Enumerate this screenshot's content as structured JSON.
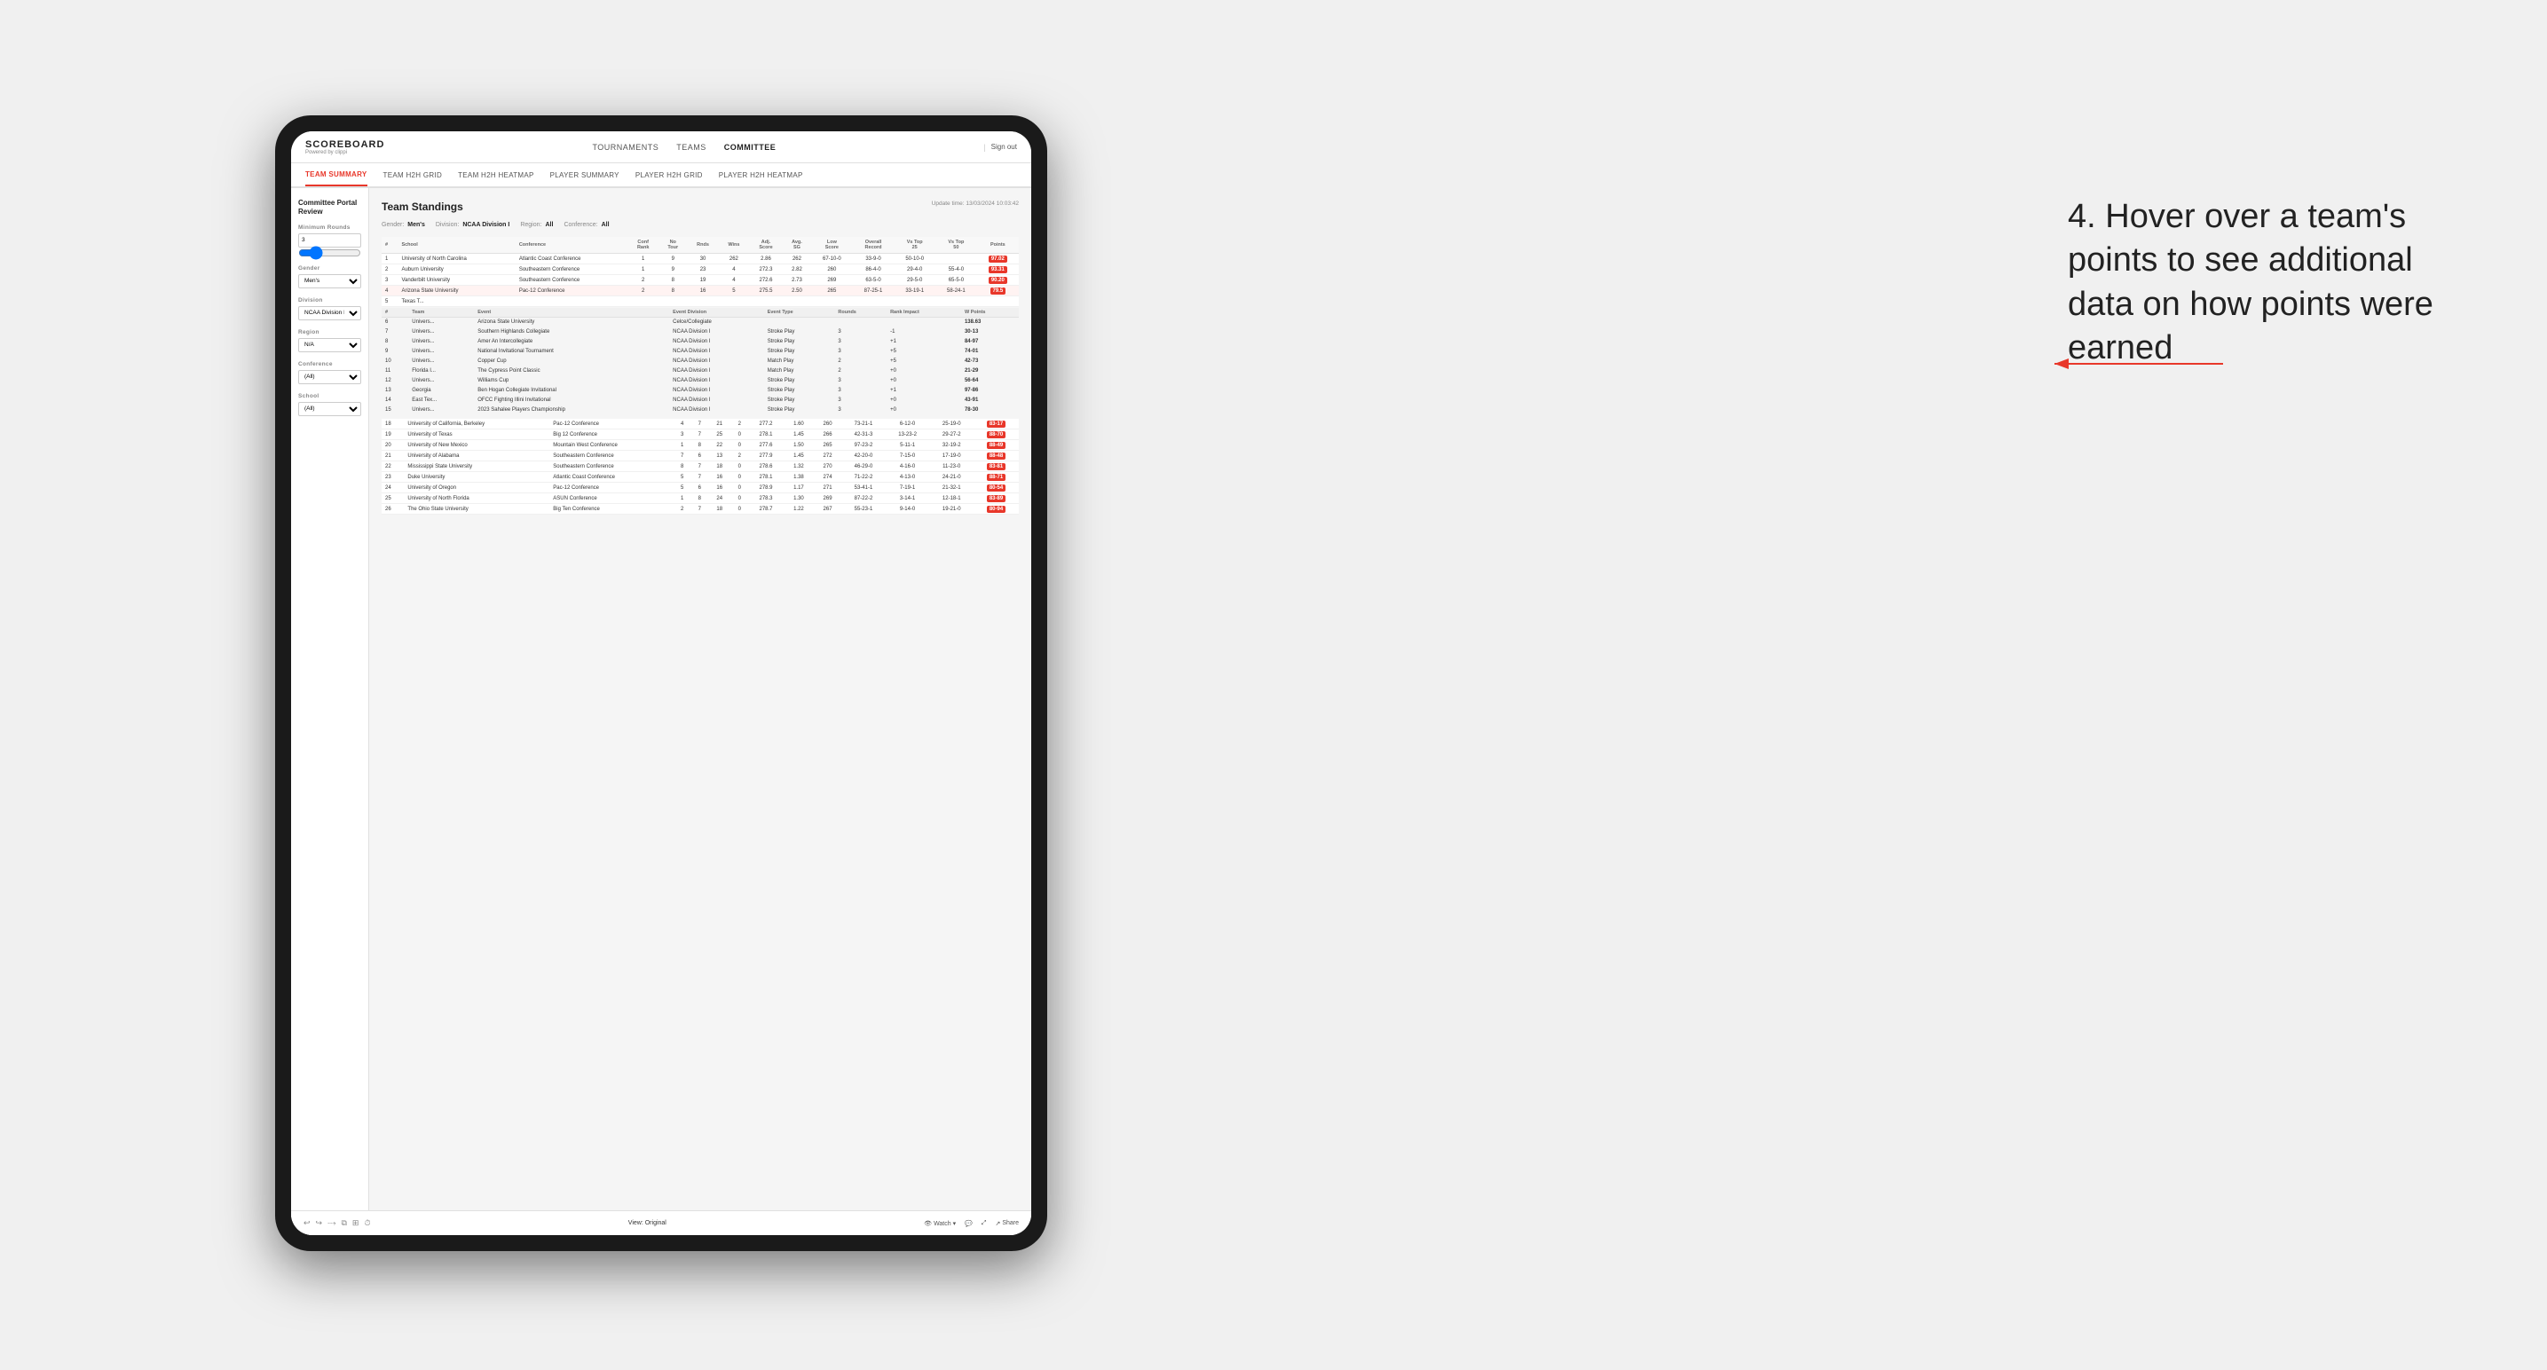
{
  "app": {
    "title": "SCOREBOARD",
    "subtitle": "Powered by clippi",
    "sign_out": "Sign out"
  },
  "nav": {
    "links": [
      "TOURNAMENTS",
      "TEAMS",
      "COMMITTEE"
    ]
  },
  "sub_tabs": [
    "TEAM SUMMARY",
    "TEAM H2H GRID",
    "TEAM H2H HEATMAP",
    "PLAYER SUMMARY",
    "PLAYER H2H GRID",
    "PLAYER H2H HEATMAP"
  ],
  "active_tab": "TEAM SUMMARY",
  "sidebar": {
    "header": "Committee Portal Review",
    "sections": [
      {
        "label": "Minimum Rounds",
        "value": ""
      },
      {
        "label": "Gender",
        "value": "Men's"
      },
      {
        "label": "Division",
        "value": "NCAA Division I"
      },
      {
        "label": "Region",
        "value": "N/A"
      },
      {
        "label": "Conference",
        "value": "(All)"
      },
      {
        "label": "School",
        "value": "(All)"
      }
    ]
  },
  "panel": {
    "title": "Team Standings",
    "update_time": "Update time: 13/03/2024 10:03:42",
    "filters": {
      "gender_label": "Gender:",
      "gender_value": "Men's",
      "division_label": "Division:",
      "division_value": "NCAA Division I",
      "region_label": "Region:",
      "region_value": "All",
      "conference_label": "Conference:",
      "conference_value": "All"
    },
    "table_headers": [
      "#",
      "School",
      "Conference",
      "Conf Rank",
      "No Tour",
      "Rnds",
      "Wins",
      "Adj. Score",
      "Avg. SG",
      "Low Score",
      "Overall Record",
      "Vs Top 25",
      "Vs Top 50",
      "Points"
    ],
    "teams": [
      {
        "rank": 1,
        "school": "University of North Carolina",
        "conference": "Atlantic Coast Conference",
        "conf_rank": 1,
        "no_tour": 9,
        "rnds": 30,
        "wins": 262,
        "adj_score": 2.86,
        "avg_sg": 262,
        "low_score": "67-10-0",
        "overall_record": "33-9-0",
        "vs_top25": "50-10-0",
        "points": "97.02",
        "highlighted": false
      },
      {
        "rank": 2,
        "school": "Auburn University",
        "conference": "Southeastern Conference",
        "conf_rank": 1,
        "no_tour": 9,
        "rnds": 23,
        "wins": 4,
        "adj_score": 272.3,
        "avg_sg": 2.82,
        "low_score": "260",
        "overall_record": "86-4-0",
        "vs_top25": "29-4-0",
        "vs_top50": "55-4-0",
        "points": "93.31",
        "highlighted": false
      },
      {
        "rank": 3,
        "school": "Vanderbilt University",
        "conference": "Southeastern Conference",
        "conf_rank": 2,
        "no_tour": 8,
        "rnds": 19,
        "wins": 4,
        "adj_score": 272.6,
        "avg_sg": 2.73,
        "low_score": "269",
        "overall_record": "63-5-0",
        "vs_top25": "29-5-0",
        "vs_top50": "65-5-0",
        "points": "90.20",
        "highlighted": false
      },
      {
        "rank": 4,
        "school": "Arizona State University",
        "conference": "Pac-12 Conference",
        "conf_rank": 2,
        "no_tour": 8,
        "rnds": 16,
        "wins": 5,
        "adj_score": 275.5,
        "avg_sg": 2.5,
        "low_score": "265",
        "overall_record": "87-25-1",
        "vs_top25": "33-19-1",
        "vs_top50": "58-24-1",
        "points": "79.5",
        "highlighted": true
      }
    ],
    "detail_rows": [
      {
        "team": "University",
        "event": "University",
        "event_division": "",
        "event_type": "",
        "rounds": "",
        "rank_impact": "",
        "w_points": ""
      },
      {
        "team": "Univers...",
        "event": "Southern Highlands Collegiate",
        "event_division": "NCAA Division I",
        "event_type": "Stroke Play",
        "rounds": 3,
        "rank_impact": "-1",
        "w_points": "30-13"
      },
      {
        "team": "Univers...",
        "event": "Amer An Intercollegiate",
        "event_division": "NCAA Division I",
        "event_type": "Stroke Play",
        "rounds": 3,
        "rank_impact": "+1",
        "w_points": "84-97"
      },
      {
        "team": "Univers...",
        "event": "National Invitational Tournament",
        "event_division": "NCAA Division I",
        "event_type": "Stroke Play",
        "rounds": 3,
        "rank_impact": "+5",
        "w_points": "74-01"
      },
      {
        "team": "Univers...",
        "event": "Copper Cup",
        "event_division": "NCAA Division I",
        "event_type": "Match Play",
        "rounds": 2,
        "rank_impact": "+5",
        "w_points": "42-73"
      },
      {
        "team": "Florida I...",
        "event": "The Cypress Point Classic",
        "event_division": "NCAA Division I",
        "event_type": "Match Play",
        "rounds": 2,
        "rank_impact": "+0",
        "w_points": "21-29"
      },
      {
        "team": "Univers...",
        "event": "Williams Cup",
        "event_division": "NCAA Division I",
        "event_type": "Stroke Play",
        "rounds": 3,
        "rank_impact": "+0",
        "w_points": "56-64"
      },
      {
        "team": "Georgia",
        "event": "Ben Hogan Collegiate Invitational",
        "event_division": "NCAA Division I",
        "event_type": "Stroke Play",
        "rounds": 3,
        "rank_impact": "+1",
        "w_points": "97-86"
      },
      {
        "team": "East Tex...",
        "event": "OFCC Fighting Illini Invitational",
        "event_division": "NCAA Division I",
        "event_type": "Stroke Play",
        "rounds": 3,
        "rank_impact": "+0",
        "w_points": "43-91"
      },
      {
        "team": "Univers...",
        "event": "2023 Sahalee Players Championship",
        "event_division": "NCAA Division I",
        "event_type": "Stroke Play",
        "rounds": 3,
        "rank_impact": "+0",
        "w_points": "78-30"
      }
    ],
    "bottom_teams": [
      {
        "rank": 18,
        "school": "University of California, Berkeley",
        "conference": "Pac-12 Conference",
        "conf_rank": 4,
        "no_tour": 7,
        "rnds": 21,
        "wins": 2,
        "adj_score": 277.2,
        "avg_sg": 1.6,
        "low_score": "260",
        "overall_record": "73-21-1",
        "vs_top25": "6-12-0",
        "vs_top50": "25-19-0",
        "points": "83-17"
      },
      {
        "rank": 19,
        "school": "University of Texas",
        "conference": "Big 12 Conference",
        "conf_rank": 3,
        "no_tour": 7,
        "rnds": 25,
        "wins": 0,
        "adj_score": 278.1,
        "avg_sg": 1.45,
        "low_score": "266",
        "overall_record": "42-31-3",
        "vs_top25": "13-23-2",
        "vs_top50": "29-27-2",
        "points": "88-70"
      },
      {
        "rank": 20,
        "school": "University of New Mexico",
        "conference": "Mountain West Conference",
        "conf_rank": 1,
        "no_tour": 8,
        "rnds": 22,
        "wins": 0,
        "adj_score": 277.6,
        "avg_sg": 1.5,
        "low_score": "265",
        "overall_record": "97-23-2",
        "vs_top25": "5-11-1",
        "vs_top50": "32-19-2",
        "points": "88-49"
      },
      {
        "rank": 21,
        "school": "University of Alabama",
        "conference": "Southeastern Conference",
        "conf_rank": 7,
        "no_tour": 6,
        "rnds": 13,
        "wins": 2,
        "adj_score": 277.9,
        "avg_sg": 1.45,
        "low_score": "272",
        "overall_record": "42-20-0",
        "vs_top25": "7-15-0",
        "vs_top50": "17-19-0",
        "points": "88-48"
      },
      {
        "rank": 22,
        "school": "Mississippi State University",
        "conference": "Southeastern Conference",
        "conf_rank": 8,
        "no_tour": 7,
        "rnds": 18,
        "wins": 0,
        "adj_score": 278.6,
        "avg_sg": 1.32,
        "low_score": "270",
        "overall_record": "46-29-0",
        "vs_top25": "4-16-0",
        "vs_top50": "11-23-0",
        "points": "83-81"
      },
      {
        "rank": 23,
        "school": "Duke University",
        "conference": "Atlantic Coast Conference",
        "conf_rank": 5,
        "no_tour": 7,
        "rnds": 16,
        "wins": 0,
        "adj_score": 278.1,
        "avg_sg": 1.38,
        "low_score": "274",
        "overall_record": "71-22-2",
        "vs_top25": "4-13-0",
        "vs_top50": "24-21-0",
        "points": "88-71"
      },
      {
        "rank": 24,
        "school": "University of Oregon",
        "conference": "Pac-12 Conference",
        "conf_rank": 5,
        "no_tour": 6,
        "rnds": 16,
        "wins": 0,
        "adj_score": 278.9,
        "avg_sg": 1.17,
        "low_score": "271",
        "overall_record": "53-41-1",
        "vs_top25": "7-19-1",
        "vs_top50": "21-32-1",
        "points": "80-54"
      },
      {
        "rank": 25,
        "school": "University of North Florida",
        "conference": "ASUN Conference",
        "conf_rank": 1,
        "no_tour": 8,
        "rnds": 24,
        "wins": 0,
        "adj_score": 278.3,
        "avg_sg": 1.3,
        "low_score": "269",
        "overall_record": "87-22-2",
        "vs_top25": "3-14-1",
        "vs_top50": "12-18-1",
        "points": "83-89"
      },
      {
        "rank": 26,
        "school": "The Ohio State University",
        "conference": "Big Ten Conference",
        "conf_rank": 2,
        "no_tour": 7,
        "rnds": 18,
        "wins": 0,
        "adj_score": 278.7,
        "avg_sg": 1.22,
        "low_score": "267",
        "overall_record": "55-23-1",
        "vs_top25": "9-14-0",
        "vs_top50": "19-21-0",
        "points": "80-94"
      }
    ]
  },
  "toolbar": {
    "view_label": "View: Original",
    "watch_label": "Watch ▾",
    "share_label": "Share"
  },
  "annotation": {
    "text": "4. Hover over a team's points to see additional data on how points were earned"
  },
  "detail_table_headers": [
    "#",
    "Team",
    "Event",
    "Event Division",
    "Event Type",
    "Rounds",
    "Rank Impact",
    "W Points"
  ]
}
